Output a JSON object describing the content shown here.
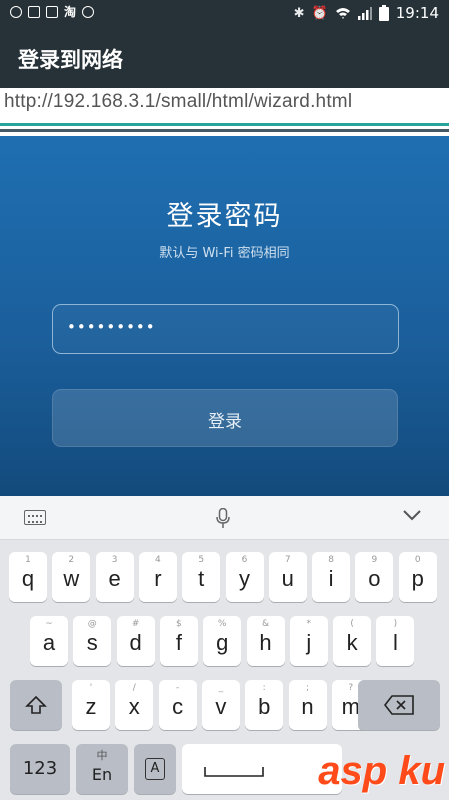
{
  "status_bar": {
    "time": "19:14"
  },
  "app_bar": {
    "title": "登录到网络"
  },
  "url": {
    "text": "http://192.168.3.1/small/html/wizard.html"
  },
  "login": {
    "title": "登录密码",
    "subtitle": "默认与 Wi-Fi 密码相同",
    "password_value": "•••••••••",
    "button_label": "登录"
  },
  "keyboard": {
    "row1": [
      {
        "ch": "q",
        "hint": "1"
      },
      {
        "ch": "w",
        "hint": "2"
      },
      {
        "ch": "e",
        "hint": "3"
      },
      {
        "ch": "r",
        "hint": "4"
      },
      {
        "ch": "t",
        "hint": "5"
      },
      {
        "ch": "y",
        "hint": "6"
      },
      {
        "ch": "u",
        "hint": "7"
      },
      {
        "ch": "i",
        "hint": "8"
      },
      {
        "ch": "o",
        "hint": "9"
      },
      {
        "ch": "p",
        "hint": "0"
      }
    ],
    "row2": [
      {
        "ch": "a",
        "hint": "~"
      },
      {
        "ch": "s",
        "hint": "@"
      },
      {
        "ch": "d",
        "hint": "#"
      },
      {
        "ch": "f",
        "hint": "$"
      },
      {
        "ch": "g",
        "hint": "%"
      },
      {
        "ch": "h",
        "hint": "&"
      },
      {
        "ch": "j",
        "hint": "*"
      },
      {
        "ch": "k",
        "hint": "("
      },
      {
        "ch": "l",
        "hint": ")"
      }
    ],
    "row3": [
      {
        "ch": "z",
        "hint": "'"
      },
      {
        "ch": "x",
        "hint": "/"
      },
      {
        "ch": "c",
        "hint": "-"
      },
      {
        "ch": "v",
        "hint": "_"
      },
      {
        "ch": "b",
        "hint": ":"
      },
      {
        "ch": "n",
        "hint": ";"
      },
      {
        "ch": "m",
        "hint": "?"
      }
    ],
    "num_key": "123",
    "lang_key_top": "中",
    "lang_key_bottom": "En",
    "mode_key": "A"
  },
  "watermark": "asp ku",
  "icons": [
    "keyboard-icon",
    "mic-icon",
    "chevron-down-icon",
    "shift-icon",
    "backspace-icon",
    "space-icon",
    "bluetooth-icon",
    "alarm-icon",
    "wifi-icon",
    "signal-icon",
    "battery-icon"
  ]
}
